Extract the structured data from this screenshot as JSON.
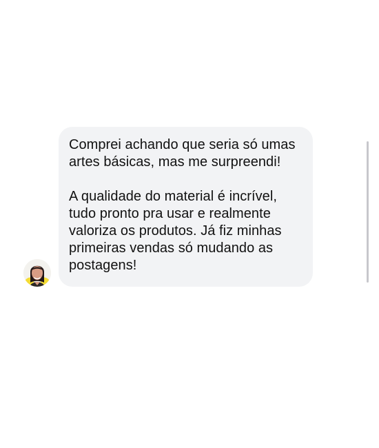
{
  "conversation": {
    "message": {
      "paragraphs": [
        "Comprei achando que seria só umas\nartes básicas, mas me surpreendi!",
        "A qualidade do material é incrível,\ntudo pronto pra usar e realmente\nvaloriza os produtos. Já fiz minhas\nprimeiras vendas só mudando as\npostagens!"
      ]
    },
    "avatar": {
      "icon": "user-avatar-icon"
    }
  },
  "colors": {
    "background": "#ffffff",
    "bubble": "#f2f3f5",
    "text": "#111111",
    "scrollbar": "#c7c7cc"
  }
}
